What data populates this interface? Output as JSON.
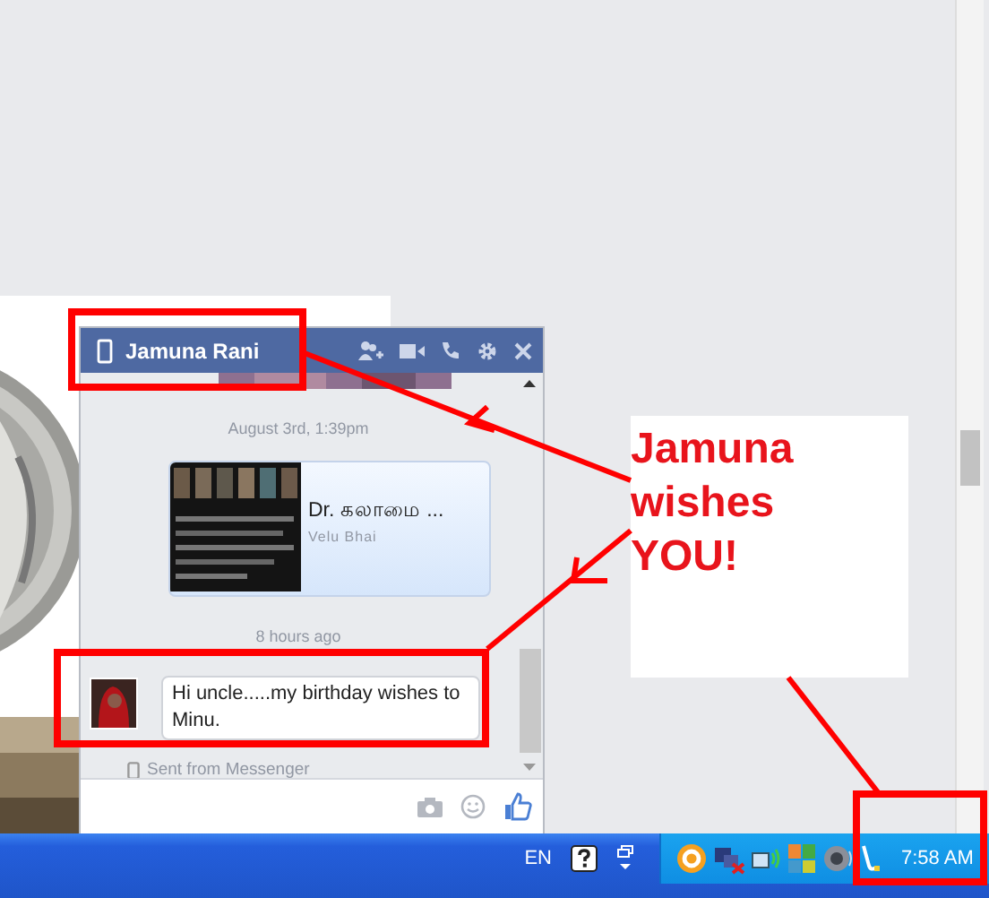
{
  "chat": {
    "title": "Jamuna Rani",
    "timestamps": [
      "August 3rd, 1:39pm",
      "8 hours ago"
    ],
    "shared_link": {
      "title": "Dr. கலாமை ...",
      "source": "Velu Bhai"
    },
    "message": {
      "text": "Hi uncle.....my birthday wishes to Minu."
    },
    "footnote": "Sent from Messenger"
  },
  "annotation": {
    "text": "Jamuna wishes YOU!"
  },
  "taskbar": {
    "language": "EN",
    "clock": "7:58 AM"
  }
}
